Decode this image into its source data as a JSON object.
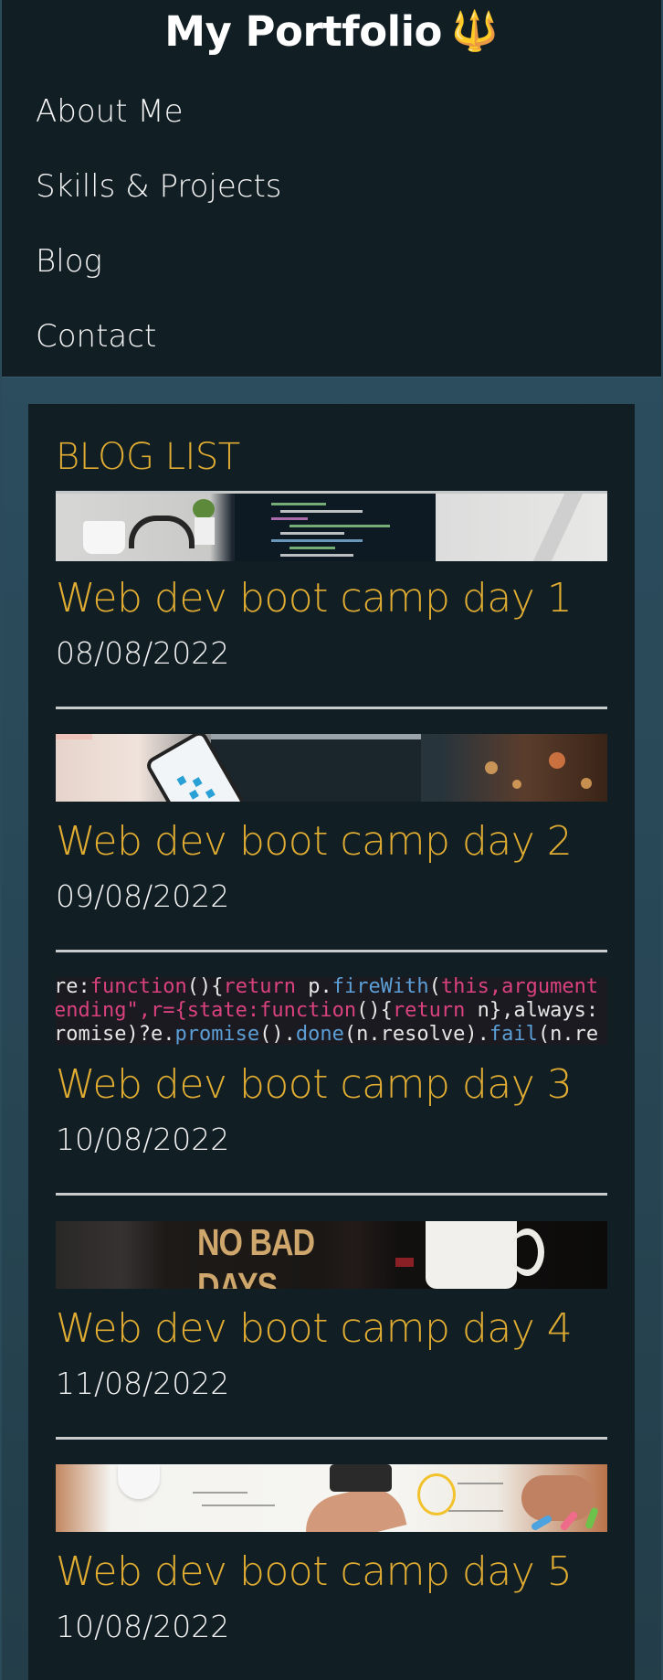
{
  "header": {
    "title": "My Portfolio",
    "title_icon": "trident-icon",
    "title_icon_glyph": "🔱"
  },
  "nav": {
    "items": [
      {
        "label": "About Me"
      },
      {
        "label": "Skills & Projects"
      },
      {
        "label": "Blog"
      },
      {
        "label": "Contact"
      }
    ]
  },
  "blog": {
    "heading": "BLOG LIST",
    "posts": [
      {
        "title": "Web dev boot camp day 1",
        "date": "08/08/2022",
        "image": "desk-laptop-code-image"
      },
      {
        "title": "Web dev boot camp day 2",
        "date": "09/08/2022",
        "image": "phone-laptop-image"
      },
      {
        "title": "Web dev boot camp day 3",
        "date": "10/08/2022",
        "image": "code-screen-image"
      },
      {
        "title": "Web dev boot camp day 4",
        "date": "11/08/2022",
        "image": "no-bad-days-image"
      },
      {
        "title": "Web dev boot camp day 5",
        "date": "10/08/2022",
        "image": "desk-papers-image"
      }
    ],
    "code_snippet": {
      "line1_a": "re:",
      "line1_kw": "function",
      "line1_b": "(){",
      "line1_kw2": "return",
      "line1_c": " p.",
      "line1_fn": "fireWith",
      "line1_d": "(",
      "line1_kw3": "this",
      "line1_e": ",argument",
      "line2_a": "ending\",r={state:",
      "line2_kw": "function",
      "line2_b": "(){",
      "line2_kw2": "return",
      "line2_c": " n},always:",
      "line3_a": "romise)?e.",
      "line3_fn": "promise",
      "line3_b": "().",
      "line3_fn2": "done",
      "line3_c": "(n.resolve).",
      "line3_fn3": "fail",
      "line3_d": "(n.re"
    },
    "sign_text": "NO BAD DAYS"
  },
  "colors": {
    "header_bg": "#111e24",
    "accent": "#e0ac32",
    "page_bg": "#2b4a5a"
  }
}
